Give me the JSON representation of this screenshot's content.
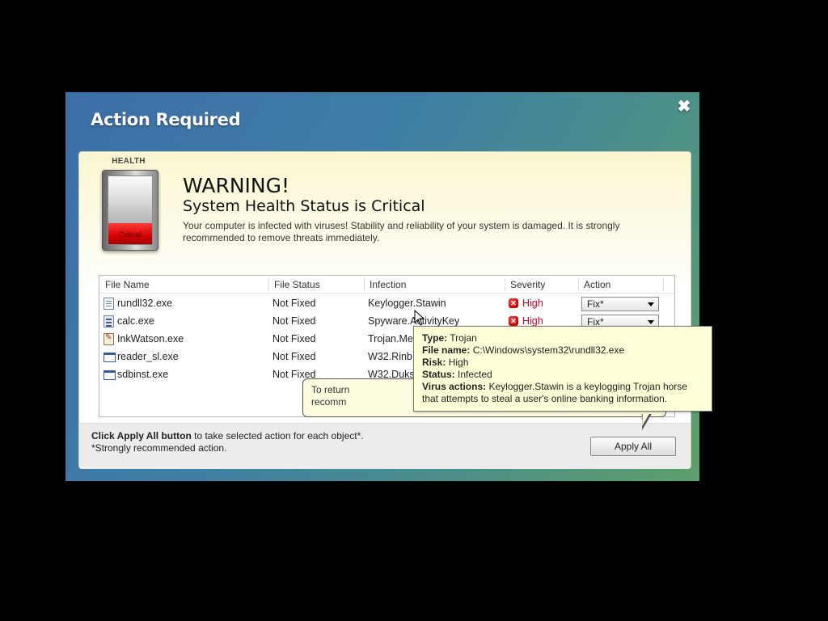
{
  "window": {
    "title": "Action Required",
    "close_icon": "✖"
  },
  "health": {
    "label": "HEALTH",
    "status": "Critical",
    "level": 0.3
  },
  "warning": {
    "title": "WARNING!",
    "subtitle": "System Health Status is Critical",
    "description": "Your computer is infected with viruses! Stability and reliability of your system is damaged. It is strongly recommended to remove threats immediately."
  },
  "table": {
    "headers": [
      "File Name",
      "File Status",
      "Infection",
      "Severity",
      "Action"
    ],
    "rows": [
      {
        "file": "rundll32.exe",
        "icon": "doc",
        "status": "Not Fixed",
        "infection": "Keylogger.Stawin",
        "severity": "High",
        "action": "Fix*"
      },
      {
        "file": "calc.exe",
        "icon": "calc",
        "status": "Not Fixed",
        "infection": "Spyware.ActivityKey",
        "severity": "High",
        "action": "Fix*"
      },
      {
        "file": "InkWatson.exe",
        "icon": "ink",
        "status": "Not Fixed",
        "infection": "Trojan.Me",
        "severity": "",
        "action": ""
      },
      {
        "file": "reader_sl.exe",
        "icon": "win",
        "status": "Not Fixed",
        "infection": "W32.Rinb",
        "severity": "",
        "action": ""
      },
      {
        "file": "sdbinst.exe",
        "icon": "win",
        "status": "Not Fixed",
        "infection": "W32.Duks",
        "severity": "",
        "action": ""
      }
    ]
  },
  "footer": {
    "bold": "Click Apply All button",
    "text": " to take selected action for each object*.",
    "note": "*Strongly recommended action.",
    "apply_label": "Apply All"
  },
  "tip_bubble": {
    "line1": "To return",
    "line2": "recomm"
  },
  "info_tooltip": {
    "type_label": "Type:",
    "type": "Trojan",
    "file_label": "File name:",
    "file": "C:\\Windows\\system32\\rundll32.exe",
    "risk_label": "Risk:",
    "risk": "High",
    "status_label": "Status:",
    "status": "Infected",
    "actions_label": "Virus actions:",
    "actions_1": "Keylogger.Stawin is a keylogging Trojan horse",
    "actions_2": "that attempts to steal a user's online banking information."
  },
  "colors": {
    "severity": "#d0002a",
    "critical": "#d60000",
    "tooltip_bg": "#ffffd8"
  }
}
